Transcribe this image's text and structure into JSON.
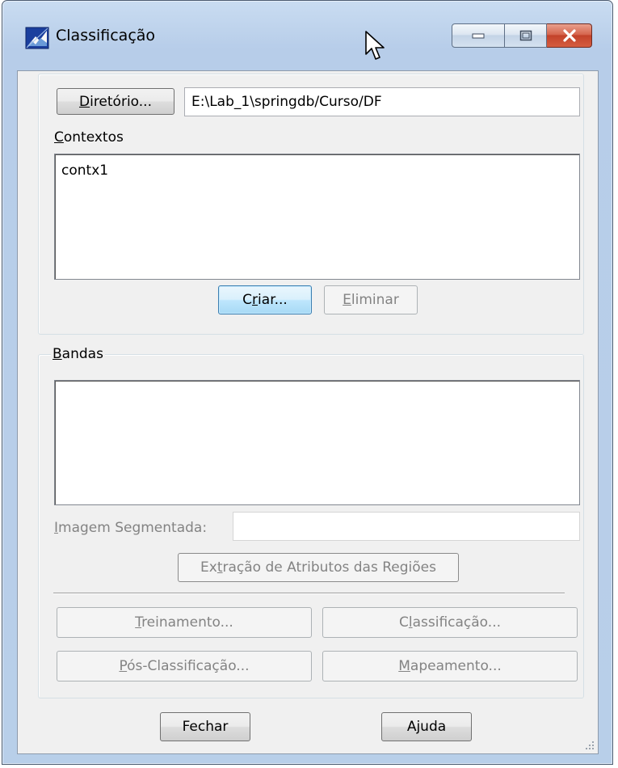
{
  "window": {
    "title": "Classificação",
    "colors": {
      "frame": "#b8cfe9",
      "close_button": "#c2422a",
      "client": "#f0f0f0"
    }
  },
  "contexts_section": {
    "directory_button": {
      "mnemonic": "D",
      "rest": "iretório..."
    },
    "directory_path": "E:\\Lab_1\\springdb/Curso/DF",
    "contexts_label": {
      "mnemonic": "C",
      "rest": "ontextos"
    },
    "contexts_list": [
      "contx1"
    ],
    "create_button": {
      "pre": "C",
      "mnemonic": "r",
      "rest": "iar..."
    },
    "delete_button": {
      "mnemonic": "E",
      "rest": "liminar"
    }
  },
  "bands_section": {
    "label": {
      "mnemonic": "B",
      "rest": "andas"
    },
    "bands_list": [],
    "segmented_image_label": {
      "mnemonic": "I",
      "rest": "magem Segmentada:"
    },
    "segmented_image_value": "",
    "extract_button": {
      "pre": "Ex",
      "mnemonic": "t",
      "rest": "ração de Atributos das Regiões"
    },
    "training_button": {
      "mnemonic": "T",
      "rest": "reinamento..."
    },
    "classification_button": {
      "pre": "C",
      "mnemonic": "l",
      "rest": "assificação..."
    },
    "post_classification_button": {
      "mnemonic": "P",
      "rest": "ós-Classificação..."
    },
    "mapping_button": {
      "mnemonic": "M",
      "rest": "apeamento..."
    }
  },
  "footer": {
    "close_button": "Fechar",
    "help_button": "Ajuda"
  }
}
